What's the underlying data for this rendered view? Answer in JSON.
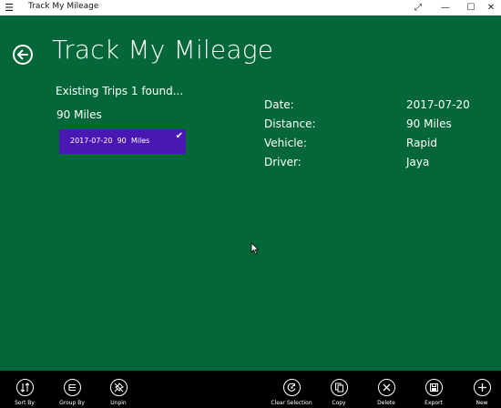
{
  "window": {
    "title": "Track My Mileage",
    "menu_icon": "hamburger-icon",
    "controls": [
      "expand-icon",
      "minimize-icon",
      "maximize-icon",
      "close-icon"
    ]
  },
  "page": {
    "title": "Track My Mileage",
    "back_icon": "back-arrow-icon"
  },
  "trips": {
    "header": "Existing Trips 1 found...",
    "total_miles": "90 Miles",
    "items": [
      {
        "label": "2017-07-20  90  Miles",
        "selected": true
      }
    ]
  },
  "details": [
    {
      "label": "Date:",
      "value": "2017-07-20"
    },
    {
      "label": "Distance:",
      "value": "90 Miles"
    },
    {
      "label": "Vehicle:",
      "value": "Rapid"
    },
    {
      "label": "Driver:",
      "value": "Jaya"
    }
  ],
  "appbar": {
    "left": [
      {
        "label": "Sort By",
        "icon": "sort-icon"
      },
      {
        "label": "Group By",
        "icon": "group-icon"
      },
      {
        "label": "Unpin",
        "icon": "unpin-icon"
      }
    ],
    "right": [
      {
        "label": "Clear Selection",
        "icon": "clear-selection-icon"
      },
      {
        "label": "Copy",
        "icon": "copy-icon"
      },
      {
        "label": "Delete",
        "icon": "delete-icon"
      },
      {
        "label": "Export",
        "icon": "export-icon"
      },
      {
        "label": "New",
        "icon": "new-icon"
      }
    ]
  },
  "colors": {
    "background": "#04673a",
    "selection": "#4a17b2",
    "appbar": "#000000",
    "titlebar": "#ffffff"
  }
}
